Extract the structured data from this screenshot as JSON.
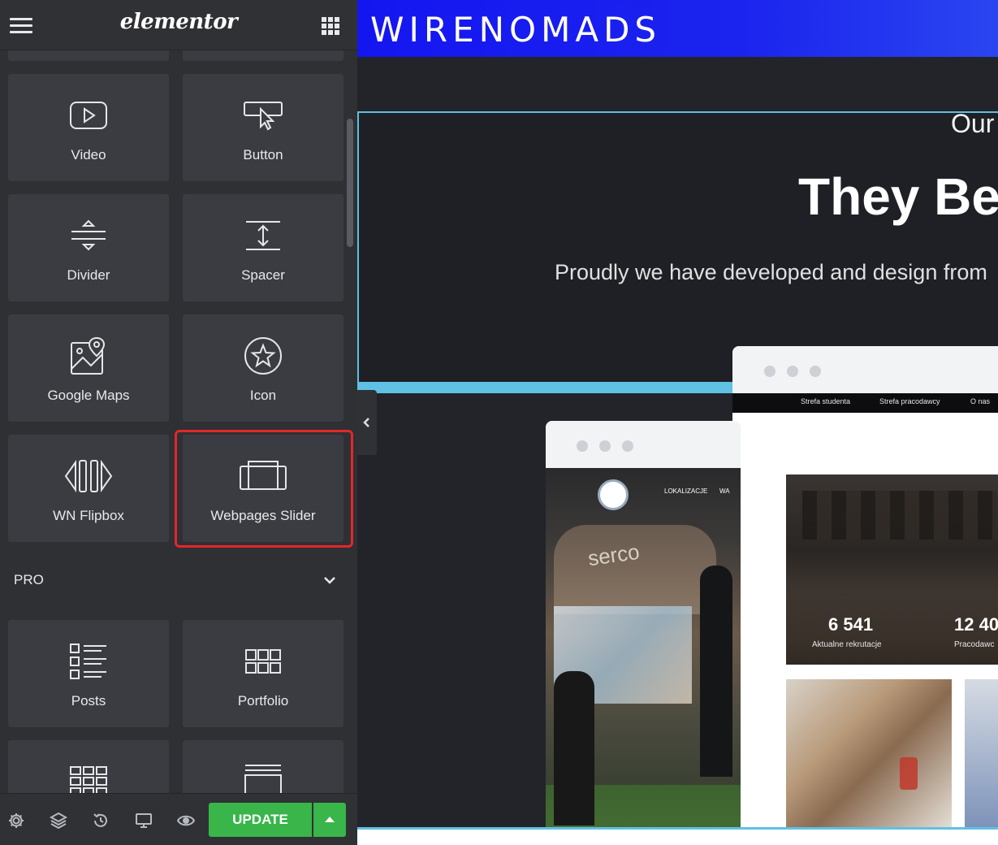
{
  "editor": {
    "logo": "elementor",
    "widgets": [
      {
        "label": "Video",
        "icon": "video-icon"
      },
      {
        "label": "Button",
        "icon": "button-icon"
      },
      {
        "label": "Divider",
        "icon": "divider-icon"
      },
      {
        "label": "Spacer",
        "icon": "spacer-icon"
      },
      {
        "label": "Google Maps",
        "icon": "map-icon"
      },
      {
        "label": "Icon",
        "icon": "star-icon"
      },
      {
        "label": "WN Flipbox",
        "icon": "flipbox-icon"
      },
      {
        "label": "Webpages Slider",
        "icon": "slider-icon"
      }
    ],
    "pro_section": {
      "label": "PRO",
      "widgets": [
        {
          "label": "Posts",
          "icon": "posts-icon"
        },
        {
          "label": "Portfolio",
          "icon": "portfolio-icon"
        }
      ]
    },
    "footer": {
      "update_label": "UPDATE"
    },
    "colors": {
      "panel_bg": "#2e3034",
      "widget_bg": "#3a3c41",
      "highlight": "#e3262b",
      "update_green": "#39b54a"
    }
  },
  "preview": {
    "brand": "WIRENOMADS",
    "hero": {
      "pretitle": "Our",
      "title": "They Be",
      "subtitle": "Proudly we have developed and design from"
    },
    "browser_back": {
      "nav": [
        "Strefa studenta",
        "Strefa pracodawcy",
        "O nas"
      ],
      "stats": [
        {
          "value": "6 541",
          "label": "Aktualne rekrutacje"
        },
        {
          "value": "12 40",
          "label": "Pracodawc"
        }
      ]
    },
    "browser_front": {
      "nav": [
        "LOKALIZACJE",
        "WA"
      ],
      "photo_text": "serco"
    },
    "colors": {
      "header_blue": "#1416f0",
      "accent_cyan": "#5fc1e3"
    }
  }
}
